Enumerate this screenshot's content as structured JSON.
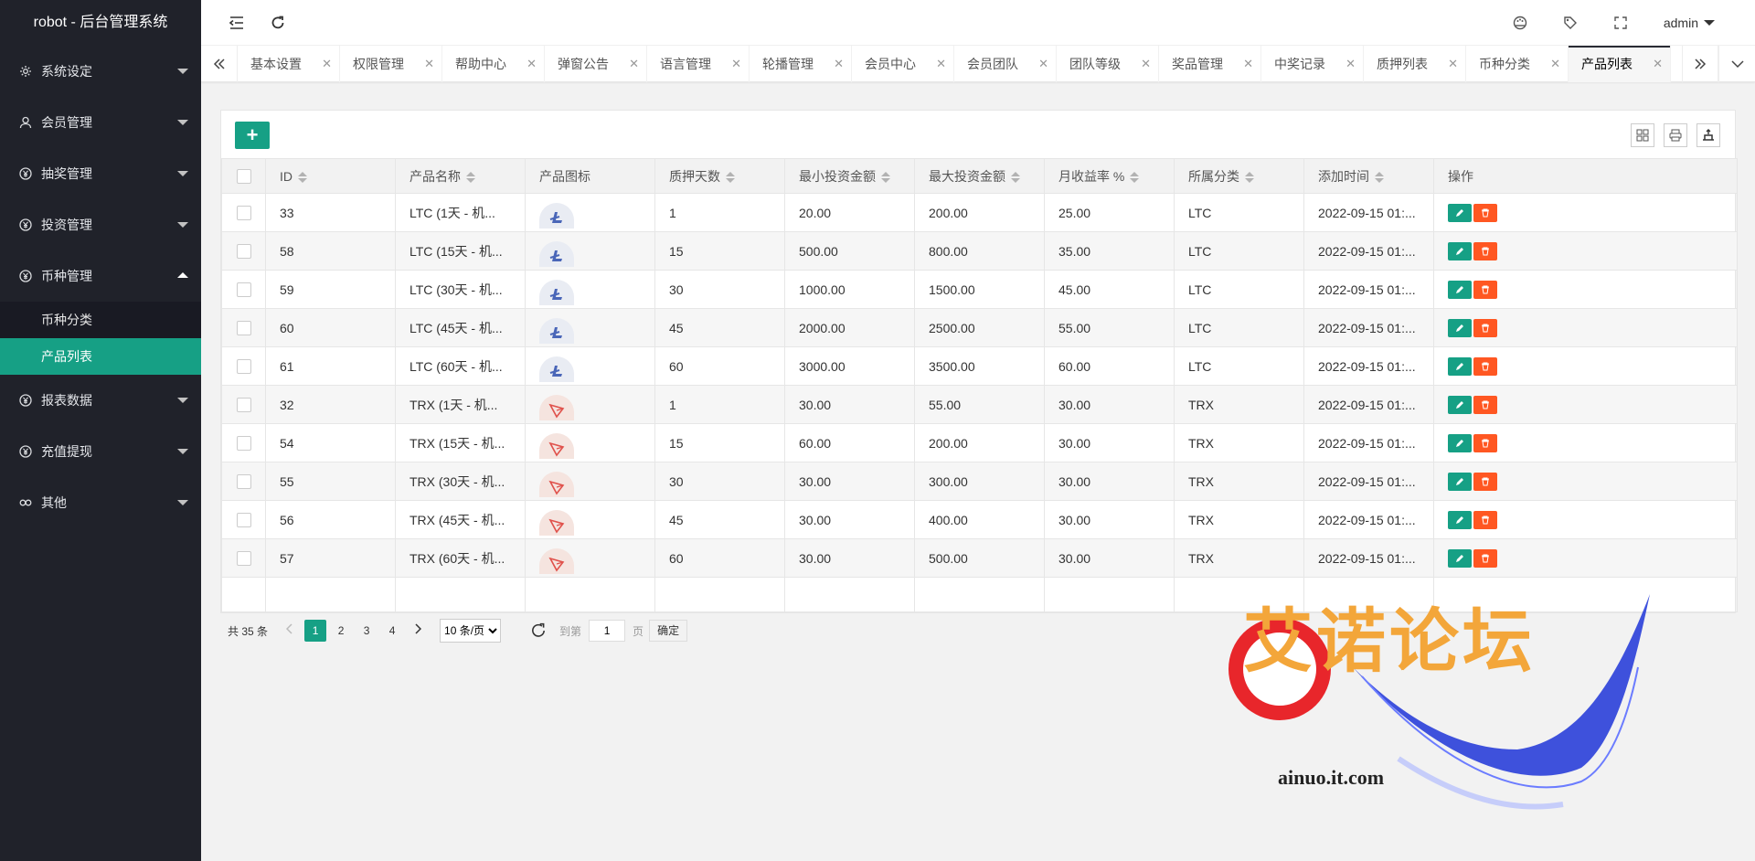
{
  "app": {
    "title": "robot - 后台管理系统",
    "user": "admin"
  },
  "sidebar": {
    "items": [
      {
        "label": "系统设定",
        "icon": "gear-icon"
      },
      {
        "label": "会员管理",
        "icon": "user-icon"
      },
      {
        "label": "抽奖管理",
        "icon": "yen-icon"
      },
      {
        "label": "投资管理",
        "icon": "yen-icon"
      },
      {
        "label": "币种管理",
        "icon": "yen-icon",
        "expanded": true
      },
      {
        "label": "报表数据",
        "icon": "yen-icon"
      },
      {
        "label": "充值提现",
        "icon": "yen-icon"
      },
      {
        "label": "其他",
        "icon": "link-icon"
      }
    ],
    "subitems": [
      {
        "label": "币种分类",
        "active": false
      },
      {
        "label": "产品列表",
        "active": true
      }
    ]
  },
  "tabs": [
    "基本设置",
    "权限管理",
    "帮助中心",
    "弹窗公告",
    "语言管理",
    "轮播管理",
    "会员中心",
    "会员团队",
    "团队等级",
    "奖品管理",
    "中奖记录",
    "质押列表",
    "币种分类",
    "产品列表"
  ],
  "active_tab": "产品列表",
  "table": {
    "columns": [
      "ID",
      "产品名称",
      "产品图标",
      "质押天数",
      "最小投资金额",
      "最大投资金额",
      "月收益率 %",
      "所属分类",
      "添加时间",
      "操作"
    ],
    "rows": [
      {
        "id": "33",
        "name": "LTC (1天 - 机...",
        "coin": "LTC",
        "days": "1",
        "min": "20.00",
        "max": "200.00",
        "rate": "25.00",
        "cat": "LTC",
        "time": "2022-09-15 01:..."
      },
      {
        "id": "58",
        "name": "LTC (15天 - 机...",
        "coin": "LTC",
        "days": "15",
        "min": "500.00",
        "max": "800.00",
        "rate": "35.00",
        "cat": "LTC",
        "time": "2022-09-15 01:..."
      },
      {
        "id": "59",
        "name": "LTC (30天 - 机...",
        "coin": "LTC",
        "days": "30",
        "min": "1000.00",
        "max": "1500.00",
        "rate": "45.00",
        "cat": "LTC",
        "time": "2022-09-15 01:..."
      },
      {
        "id": "60",
        "name": "LTC (45天 - 机...",
        "coin": "LTC",
        "days": "45",
        "min": "2000.00",
        "max": "2500.00",
        "rate": "55.00",
        "cat": "LTC",
        "time": "2022-09-15 01:..."
      },
      {
        "id": "61",
        "name": "LTC (60天 - 机...",
        "coin": "LTC",
        "days": "60",
        "min": "3000.00",
        "max": "3500.00",
        "rate": "60.00",
        "cat": "LTC",
        "time": "2022-09-15 01:..."
      },
      {
        "id": "32",
        "name": "TRX (1天 - 机...",
        "coin": "TRX",
        "days": "1",
        "min": "30.00",
        "max": "55.00",
        "rate": "30.00",
        "cat": "TRX",
        "time": "2022-09-15 01:..."
      },
      {
        "id": "54",
        "name": "TRX (15天 - 机...",
        "coin": "TRX",
        "days": "15",
        "min": "60.00",
        "max": "200.00",
        "rate": "30.00",
        "cat": "TRX",
        "time": "2022-09-15 01:..."
      },
      {
        "id": "55",
        "name": "TRX (30天 - 机...",
        "coin": "TRX",
        "days": "30",
        "min": "30.00",
        "max": "300.00",
        "rate": "30.00",
        "cat": "TRX",
        "time": "2022-09-15 01:..."
      },
      {
        "id": "56",
        "name": "TRX (45天 - 机...",
        "coin": "TRX",
        "days": "45",
        "min": "30.00",
        "max": "400.00",
        "rate": "30.00",
        "cat": "TRX",
        "time": "2022-09-15 01:..."
      },
      {
        "id": "57",
        "name": "TRX (60天 - 机...",
        "coin": "TRX",
        "days": "60",
        "min": "30.00",
        "max": "500.00",
        "rate": "30.00",
        "cat": "TRX",
        "time": "2022-09-15 01:..."
      }
    ]
  },
  "pager": {
    "total": "共 35 条",
    "pages": [
      "1",
      "2",
      "3",
      "4"
    ],
    "current": "1",
    "page_size": "10 条/页",
    "goto_label": "到第",
    "goto_value": "1",
    "page_unit": "页",
    "confirm": "确定"
  },
  "watermark": {
    "logo_text": "艾诺论坛",
    "url": "ainuo.it.com"
  },
  "colors": {
    "sidebar_bg": "#20222a",
    "accent": "#16a085",
    "danger": "#ff5722"
  }
}
